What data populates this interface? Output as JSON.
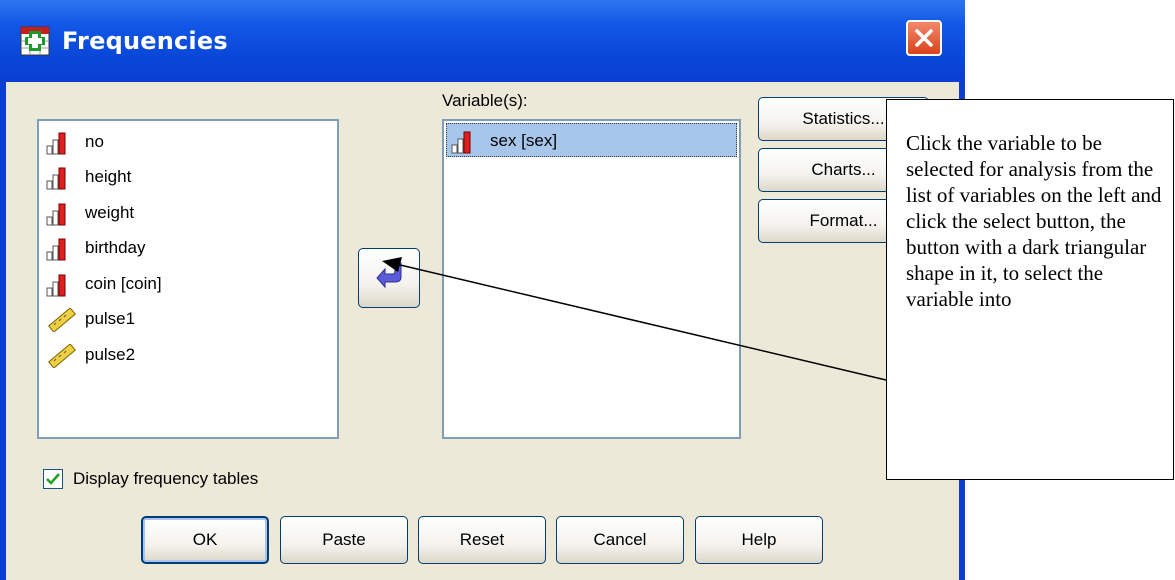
{
  "window": {
    "title": "Frequencies",
    "close_icon": "close-icon",
    "app_icon": "spss-dialog-icon"
  },
  "source_list": {
    "items": [
      {
        "label": "no",
        "icon": "ordinal-variable-icon"
      },
      {
        "label": "height",
        "icon": "ordinal-variable-icon"
      },
      {
        "label": "weight",
        "icon": "ordinal-variable-icon"
      },
      {
        "label": "birthday",
        "icon": "ordinal-variable-icon"
      },
      {
        "label": "coin [coin]",
        "icon": "ordinal-variable-icon"
      },
      {
        "label": "pulse1",
        "icon": "scale-variable-icon"
      },
      {
        "label": "pulse2",
        "icon": "scale-variable-icon"
      }
    ]
  },
  "target": {
    "label": "Variable(s):",
    "items": [
      {
        "label": "sex [sex]",
        "icon": "ordinal-variable-icon",
        "selected": true
      }
    ]
  },
  "side_buttons": {
    "statistics": "Statistics...",
    "charts": "Charts...",
    "format": "Format..."
  },
  "move_button_icon": "move-arrow-icon",
  "checkbox": {
    "label": "Display frequency tables",
    "checked": true
  },
  "bottom_buttons": {
    "ok": "OK",
    "paste": "Paste",
    "reset": "Reset",
    "cancel": "Cancel",
    "help": "Help"
  },
  "callout": {
    "text": "Click the variable to be selected for analysis from the list of variables on the left and click the select button, the button with a dark triangular shape in it, to select the variable into"
  },
  "colors": {
    "titlebar": "#0a3fd0",
    "dialog_bg": "#ece9d8",
    "selection": "#a6c6eb",
    "close_button": "#d8431c"
  }
}
